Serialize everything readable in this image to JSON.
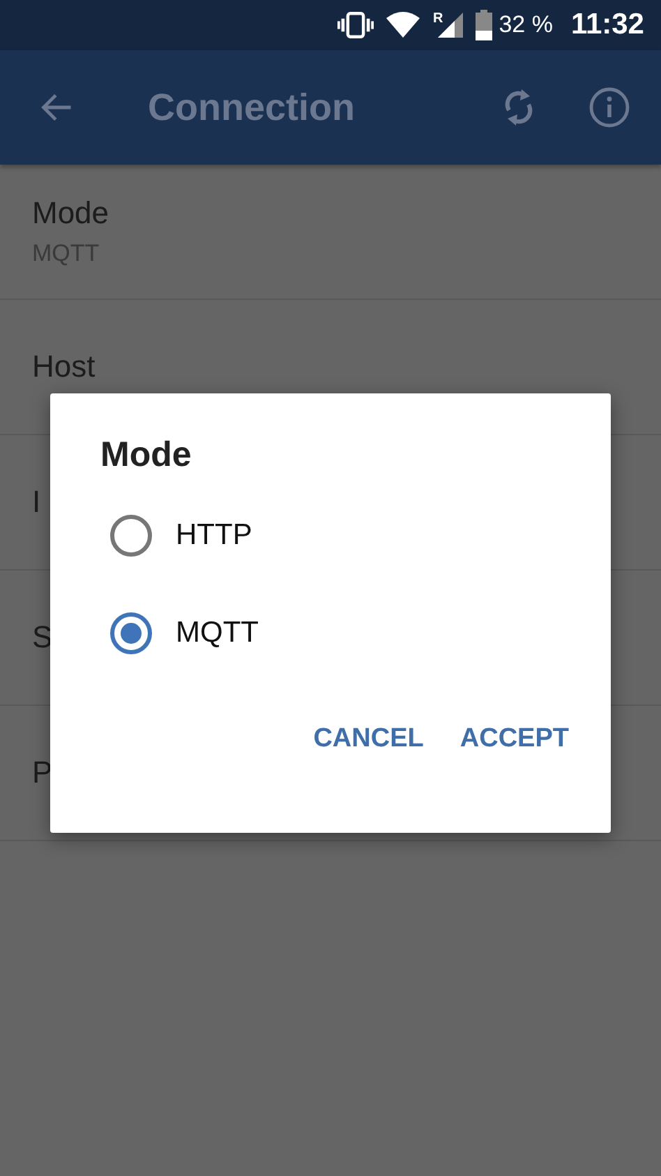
{
  "status_bar": {
    "roaming": "R",
    "battery": "32 %",
    "time": "11:32"
  },
  "app_bar": {
    "title": "Connection"
  },
  "settings": [
    {
      "title": "Mode",
      "summary": "MQTT"
    },
    {
      "title": "Host"
    },
    {
      "title": "I"
    },
    {
      "title": "S"
    },
    {
      "title": "P"
    }
  ],
  "dialog": {
    "title": "Mode",
    "options": [
      {
        "label": "HTTP",
        "selected": false
      },
      {
        "label": "MQTT",
        "selected": true
      }
    ],
    "buttons": [
      "CANCEL",
      "ACCEPT"
    ]
  }
}
